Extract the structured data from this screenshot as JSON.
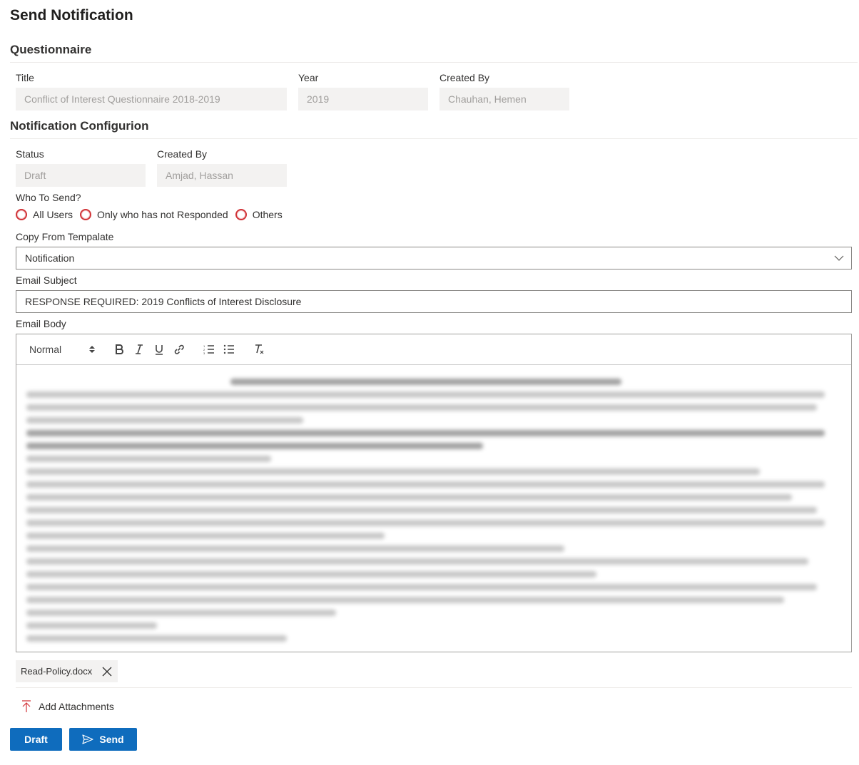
{
  "page": {
    "title": "Send Notification"
  },
  "questionnaire": {
    "section_title": "Questionnaire",
    "title_label": "Title",
    "title_value": "Conflict of Interest Questionnaire 2018-2019",
    "year_label": "Year",
    "year_value": "2019",
    "created_by_label": "Created By",
    "created_by_value": "Chauhan, Hemen"
  },
  "notification": {
    "section_title": "Notification Configurion",
    "status_label": "Status",
    "status_value": "Draft",
    "created_by_label": "Created By",
    "created_by_value": "Amjad, Hassan",
    "who_to_send_label": "Who To Send?",
    "who_options": [
      "All Users",
      "Only who has not Responded",
      "Others"
    ],
    "copy_template_label": "Copy From Tempalate",
    "copy_template_value": "Notification",
    "email_subject_label": "Email Subject",
    "email_subject_value": "RESPONSE REQUIRED: 2019 Conflicts of Interest Disclosure",
    "email_body_label": "Email Body"
  },
  "editor": {
    "format_select": "Normal",
    "icons": [
      "bold-icon",
      "italic-icon",
      "underline-icon",
      "link-icon",
      "ordered-list-icon",
      "bullet-list-icon",
      "clear-format-icon"
    ]
  },
  "attachments": {
    "files": [
      "Read-Policy.docx"
    ],
    "add_label": "Add Attachments"
  },
  "actions": {
    "draft_label": "Draft",
    "send_label": "Send"
  },
  "colors": {
    "primary": "#0f6cbd",
    "radio_border": "#d13438",
    "readonly_bg": "#f3f2f1"
  }
}
